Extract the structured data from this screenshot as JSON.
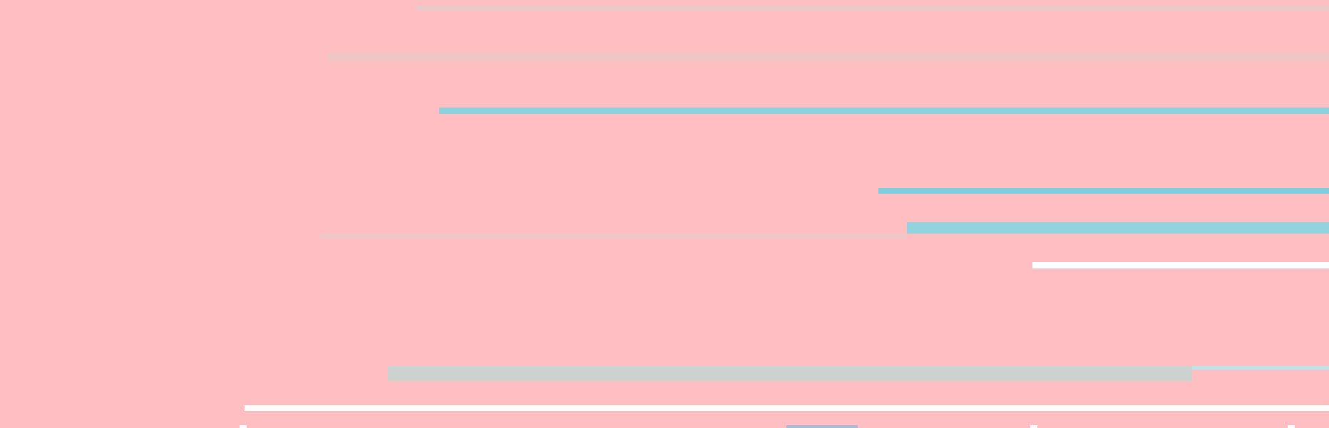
{
  "background": "#ffbfc2",
  "stripes": [
    {
      "name": "stripe-gray-top",
      "color": "#e9c9ca"
    },
    {
      "name": "stripe-gray-upper",
      "color": "#f0c6c4"
    },
    {
      "name": "stripe-teal-upper",
      "color": "#8dd1dc"
    },
    {
      "name": "stripe-teal-middle",
      "color": "#7bcfdf"
    },
    {
      "name": "stripe-gray-middle",
      "color": "#efc7c6"
    },
    {
      "name": "stripe-teal-lower",
      "color": "#92d3de"
    },
    {
      "name": "stripe-white-lower",
      "color": "#ffffff"
    },
    {
      "name": "stripe-gray-bottom",
      "color": "#ccd2cf"
    },
    {
      "name": "stripe-white-bottom",
      "color": "#ffffff"
    },
    {
      "name": "stripe-teal-thin",
      "color": "#b8e6ea"
    }
  ],
  "ticks": [
    {
      "name": "tick-1",
      "color": "#ffffff"
    },
    {
      "name": "tick-2",
      "color": "#b0b8d8"
    },
    {
      "name": "tick-3",
      "color": "#ffffff"
    },
    {
      "name": "tick-4",
      "color": "#ffffff"
    }
  ]
}
